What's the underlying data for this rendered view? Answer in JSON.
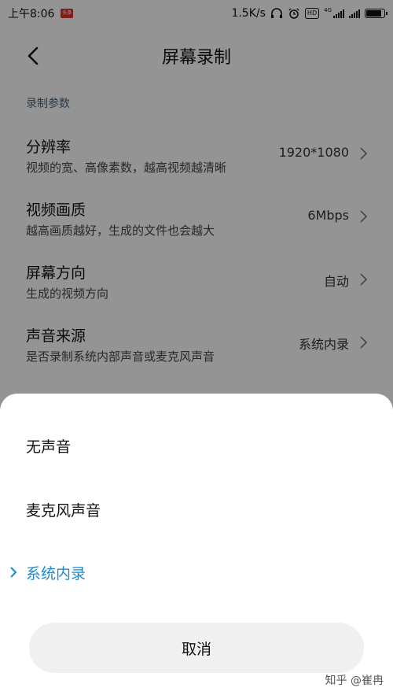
{
  "status_bar": {
    "time": "上午8:06",
    "notification_badge": "头条",
    "net_speed": "1.5K/s",
    "hd_badge": "HD",
    "network_type": "4G",
    "battery_level_percent": 90
  },
  "header": {
    "title": "屏幕录制"
  },
  "settings": {
    "section_label": "录制参数",
    "items": [
      {
        "title": "分辨率",
        "subtitle": "视频的宽、高像素数，越高视频越清晰",
        "value": "1920*1080"
      },
      {
        "title": "视频画质",
        "subtitle": "越高画质越好，生成的文件也会越大",
        "value": "6Mbps"
      },
      {
        "title": "屏幕方向",
        "subtitle": "生成的视频方向",
        "value": "自动"
      },
      {
        "title": "声音来源",
        "subtitle": "是否录制系统内部声音或麦克风声音",
        "value": "系统内录"
      }
    ]
  },
  "sheet": {
    "options": [
      {
        "label": "无声音",
        "selected": false
      },
      {
        "label": "麦克风声音",
        "selected": false
      },
      {
        "label": "系统内录",
        "selected": true
      }
    ],
    "cancel_label": "取消"
  },
  "watermark": "知乎 @崔冉",
  "colors": {
    "accent": "#1a8ad1",
    "section_label": "#4a6277"
  }
}
